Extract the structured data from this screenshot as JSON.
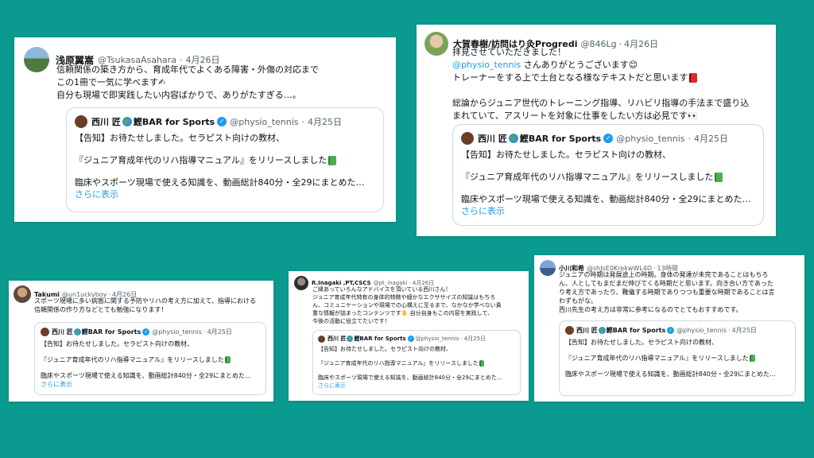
{
  "tweet1": {
    "name": "浅原翼嵩",
    "handle": "@TsukasaAsahara",
    "dot": "·",
    "date": "4月26日",
    "lines": [
      "信頼関係の築き方から、育成年代でよくある障害・外傷の対応まで",
      "この1冊で一気に学べます✍",
      "自分も現場で即実践したい内容ばかりで、ありがたすぎる…。"
    ]
  },
  "tweet2": {
    "name": "大賀春樹/訪問はり灸Progredi",
    "handle": "@846Lg",
    "dot": "·",
    "date": "4月26日",
    "line1": "拝見させていただきました！",
    "mention": "@physio_tennis",
    "mention_rest": " さんありがとうございます😊",
    "line3": "トレーナーをする上で土台となる様なテキストだと思います",
    "line4": "総論からジュニア世代のトレーニング指導、リハビリ指導の手法まで盛り込",
    "line5": "まれていて、アスリートを対象に仕事をしたい方は必見です👀"
  },
  "tweet3": {
    "name": "Takumi",
    "handle": "@un1uckyboy",
    "dot": "·",
    "date": "4月26日",
    "lines": [
      "スポーツ現場に多い病態に関する予防やリハの考え方に加えて、指導における",
      "信頼関係の作り方などとても勉強になります！"
    ]
  },
  "tweet4": {
    "name": "R.Inagaki ,PT,CSCS",
    "handle": "@pt_inagaki",
    "dot": "·",
    "date": "4月26日",
    "lines": [
      "ご縁あっていろんなアドバイスを頂いている西川さん！",
      "ジュニア育成年代特有の身体的特徴や細かなエクササイズの知識はもちろ",
      "ん、コミュニケーションや現場での心構えに至るまで、なかなか学べない貴",
      "重な情報が詰まったコンテンツです✋ 自分自身もこの内容を実践して、",
      "今後の活動に役立てたいです！"
    ]
  },
  "tweet5": {
    "name": "小川和希",
    "handle": "@shJsE0KrekwWL4D",
    "dot": "·",
    "date": "13時間",
    "lines": [
      "ジュニアの時期は発展途上の時期。身体の発達が未完であることはもちろ",
      "ん、人としてもまだまだ伸びてくる時期だと思います。向き合い方であった",
      "り考え方であったり、難儀する時期でありつつも重要な時期であることは言",
      "わずもがな。",
      "西川先生の考え方は非常に参考になるのでとてもおすすめです。"
    ]
  },
  "quote": {
    "name_a": "西川 匠",
    "name_b": "鰹BAR for Sports",
    "verified": "✓",
    "handle": "@physio_tennis",
    "dot": "·",
    "date": "4月25日",
    "line1": "【告知】お待たせしました。セラピスト向けの教材、",
    "line2": "『ジュニア育成年代のリハ指導マニュアル』をリリースしました",
    "line3": "臨床やスポーツ現場で使える知識を、動画総計840分・全29にまとめた…",
    "more": "さらに表示"
  },
  "colors": {
    "background": "#0b9a8f",
    "link": "#1d9bf0",
    "text": "#0f1419",
    "muted": "#536471"
  }
}
